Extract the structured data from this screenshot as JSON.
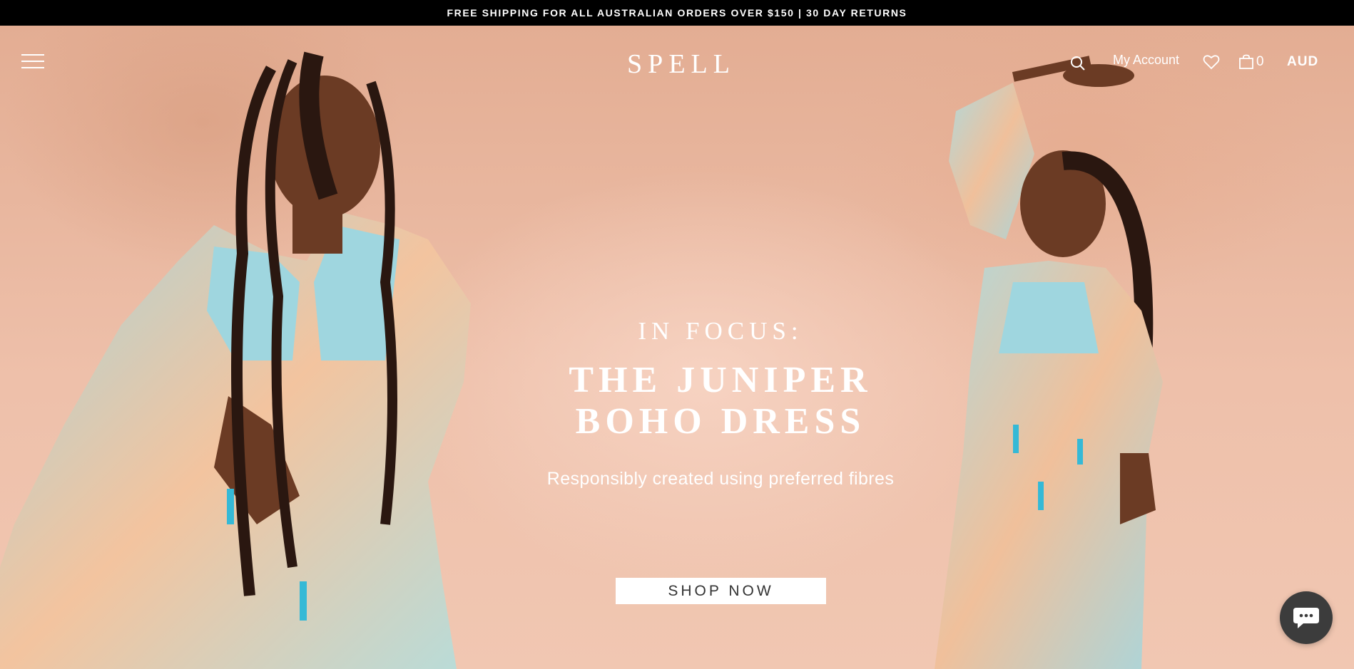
{
  "announcement": {
    "text": "FREE SHIPPING FOR ALL AUSTRALIAN ORDERS OVER $150 | 30 DAY RETURNS"
  },
  "header": {
    "logo": "SPELL",
    "account_label": "My Account",
    "cart_count": "0",
    "currency": "AUD"
  },
  "hero": {
    "kicker": "IN FOCUS:",
    "headline_line1": "THE JUNIPER",
    "headline_line2": "BOHO DRESS",
    "subtitle": "Responsibly created using preferred fibres",
    "cta_label": "SHOP NOW"
  },
  "icons": {
    "menu": "hamburger-menu-icon",
    "search": "search-icon",
    "wishlist": "heart-icon",
    "cart": "shopping-bag-icon",
    "chat": "chat-bubble-icon"
  },
  "colors": {
    "announcement_bg": "#000000",
    "hero_bg": "#e9b9a2",
    "dress_blue": "#9fd6df",
    "dress_peach": "#f2b98f",
    "chat_bg": "#3c3c3c"
  }
}
